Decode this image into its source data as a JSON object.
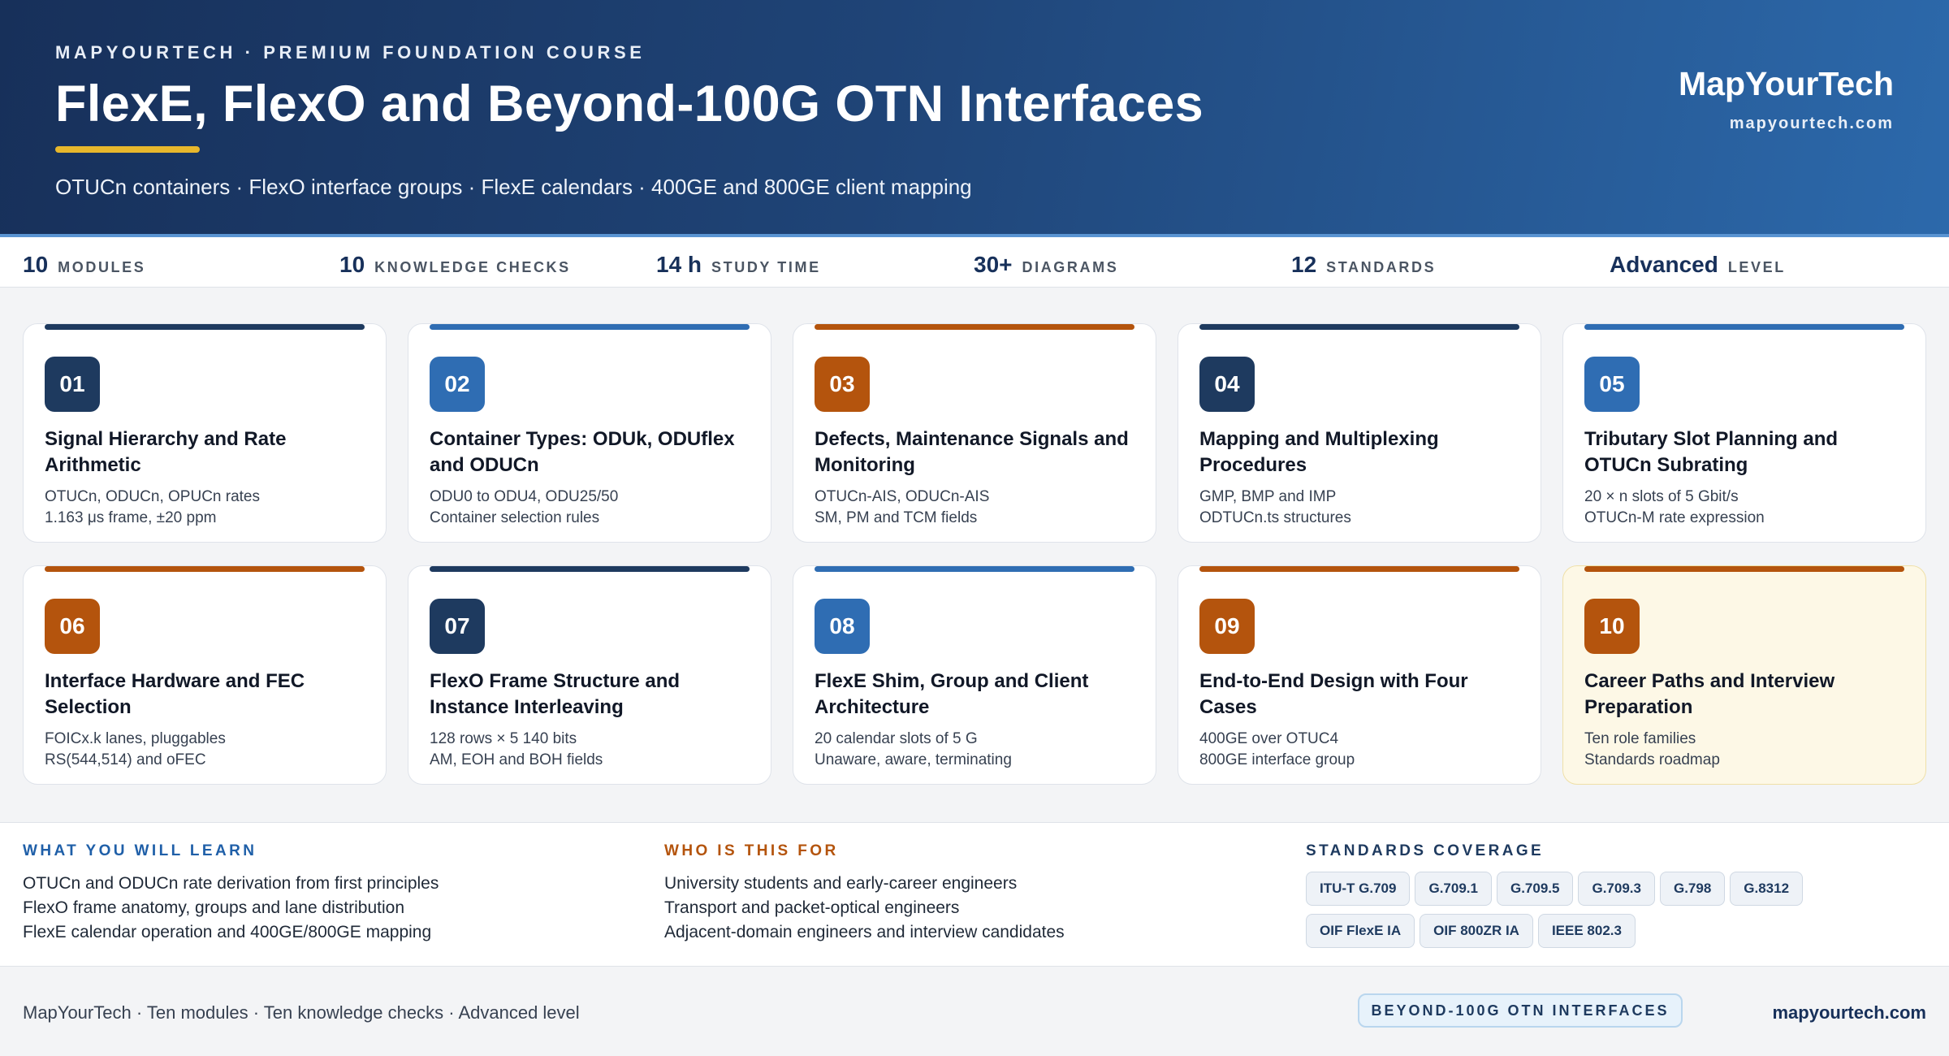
{
  "header": {
    "eyebrow": "MAPYOURTECH · PREMIUM FOUNDATION COURSE",
    "title": "FlexE, FlexO and Beyond-100G OTN Interfaces",
    "subtitle": "OTUCn containers · FlexO interface groups · FlexE calendars · 400GE and 800GE client mapping",
    "brand": "MapYourTech",
    "brand_url": "mapyourtech.com",
    "accent_color": "#e7b72c"
  },
  "stats": [
    {
      "value": "10",
      "label": "MODULES"
    },
    {
      "value": "10",
      "label": "KNOWLEDGE CHECKS"
    },
    {
      "value": "14 h",
      "label": "STUDY TIME"
    },
    {
      "value": "30+",
      "label": "DIAGRAMS"
    },
    {
      "value": "12",
      "label": "STANDARDS"
    },
    {
      "value": "Advanced",
      "label": "LEVEL"
    }
  ],
  "modules": [
    {
      "num": "01",
      "title": "Signal Hierarchy and Rate Arithmetic",
      "d1": "OTUCn, ODUCn, OPUCn rates",
      "d2": "1.163 μs frame, ±20 ppm",
      "color": "navy"
    },
    {
      "num": "02",
      "title": "Container Types: ODUk, ODUflex and ODUCn",
      "d1": "ODU0 to ODU4, ODU25/50",
      "d2": "Container selection rules",
      "color": "blue"
    },
    {
      "num": "03",
      "title": "Defects, Maintenance Signals and Monitoring",
      "d1": "OTUCn-AIS, ODUCn-AIS",
      "d2": "SM, PM and TCM fields",
      "color": "orange"
    },
    {
      "num": "04",
      "title": "Mapping and Multiplexing Procedures",
      "d1": "GMP, BMP and IMP",
      "d2": "ODTUCn.ts structures",
      "color": "navy"
    },
    {
      "num": "05",
      "title": "Tributary Slot Planning and OTUCn Subrating",
      "d1": "20 × n slots of 5 Gbit/s",
      "d2": "OTUCn-M rate expression",
      "color": "blue"
    },
    {
      "num": "06",
      "title": "Interface Hardware and FEC Selection",
      "d1": "FOICx.k lanes, pluggables",
      "d2": "RS(544,514) and oFEC",
      "color": "orange"
    },
    {
      "num": "07",
      "title": "FlexO Frame Structure and Instance Interleaving",
      "d1": "128 rows × 5 140 bits",
      "d2": "AM, EOH and BOH fields",
      "color": "navy"
    },
    {
      "num": "08",
      "title": "FlexE Shim, Group and Client Architecture",
      "d1": "20 calendar slots of 5 G",
      "d2": "Unaware, aware, terminating",
      "color": "blue"
    },
    {
      "num": "09",
      "title": "End-to-End Design with Four Cases",
      "d1": "400GE over OTUC4",
      "d2": "800GE interface group",
      "color": "orange"
    },
    {
      "num": "10",
      "title": "Career Paths and Interview Preparation",
      "d1": "Ten role families",
      "d2": "Standards roadmap",
      "color": "orange"
    }
  ],
  "learn": {
    "heading": "WHAT YOU WILL LEARN",
    "color": "#1f5fa8",
    "items": [
      "OTUCn and ODUCn rate derivation from first principles",
      "FlexO frame anatomy, groups and lane distribution",
      "FlexE calendar operation and 400GE/800GE mapping"
    ]
  },
  "audience": {
    "heading": "WHO IS THIS FOR",
    "color": "#b4540d",
    "items": [
      "University students and early-career engineers",
      "Transport and packet-optical engineers",
      "Adjacent-domain engineers and interview candidates"
    ]
  },
  "standards": {
    "heading": "STANDARDS COVERAGE",
    "color": "#1e3a5f",
    "items": [
      "ITU-T G.709",
      "G.709.1",
      "G.709.5",
      "G.709.3",
      "G.798",
      "G.8312",
      "OIF FlexE IA",
      "OIF 800ZR IA",
      "IEEE 802.3"
    ]
  },
  "footer": {
    "left": "MapYourTech · Ten modules · Ten knowledge checks · Advanced level",
    "badge": "BEYOND-100G OTN INTERFACES",
    "right": "mapyourtech.com"
  }
}
